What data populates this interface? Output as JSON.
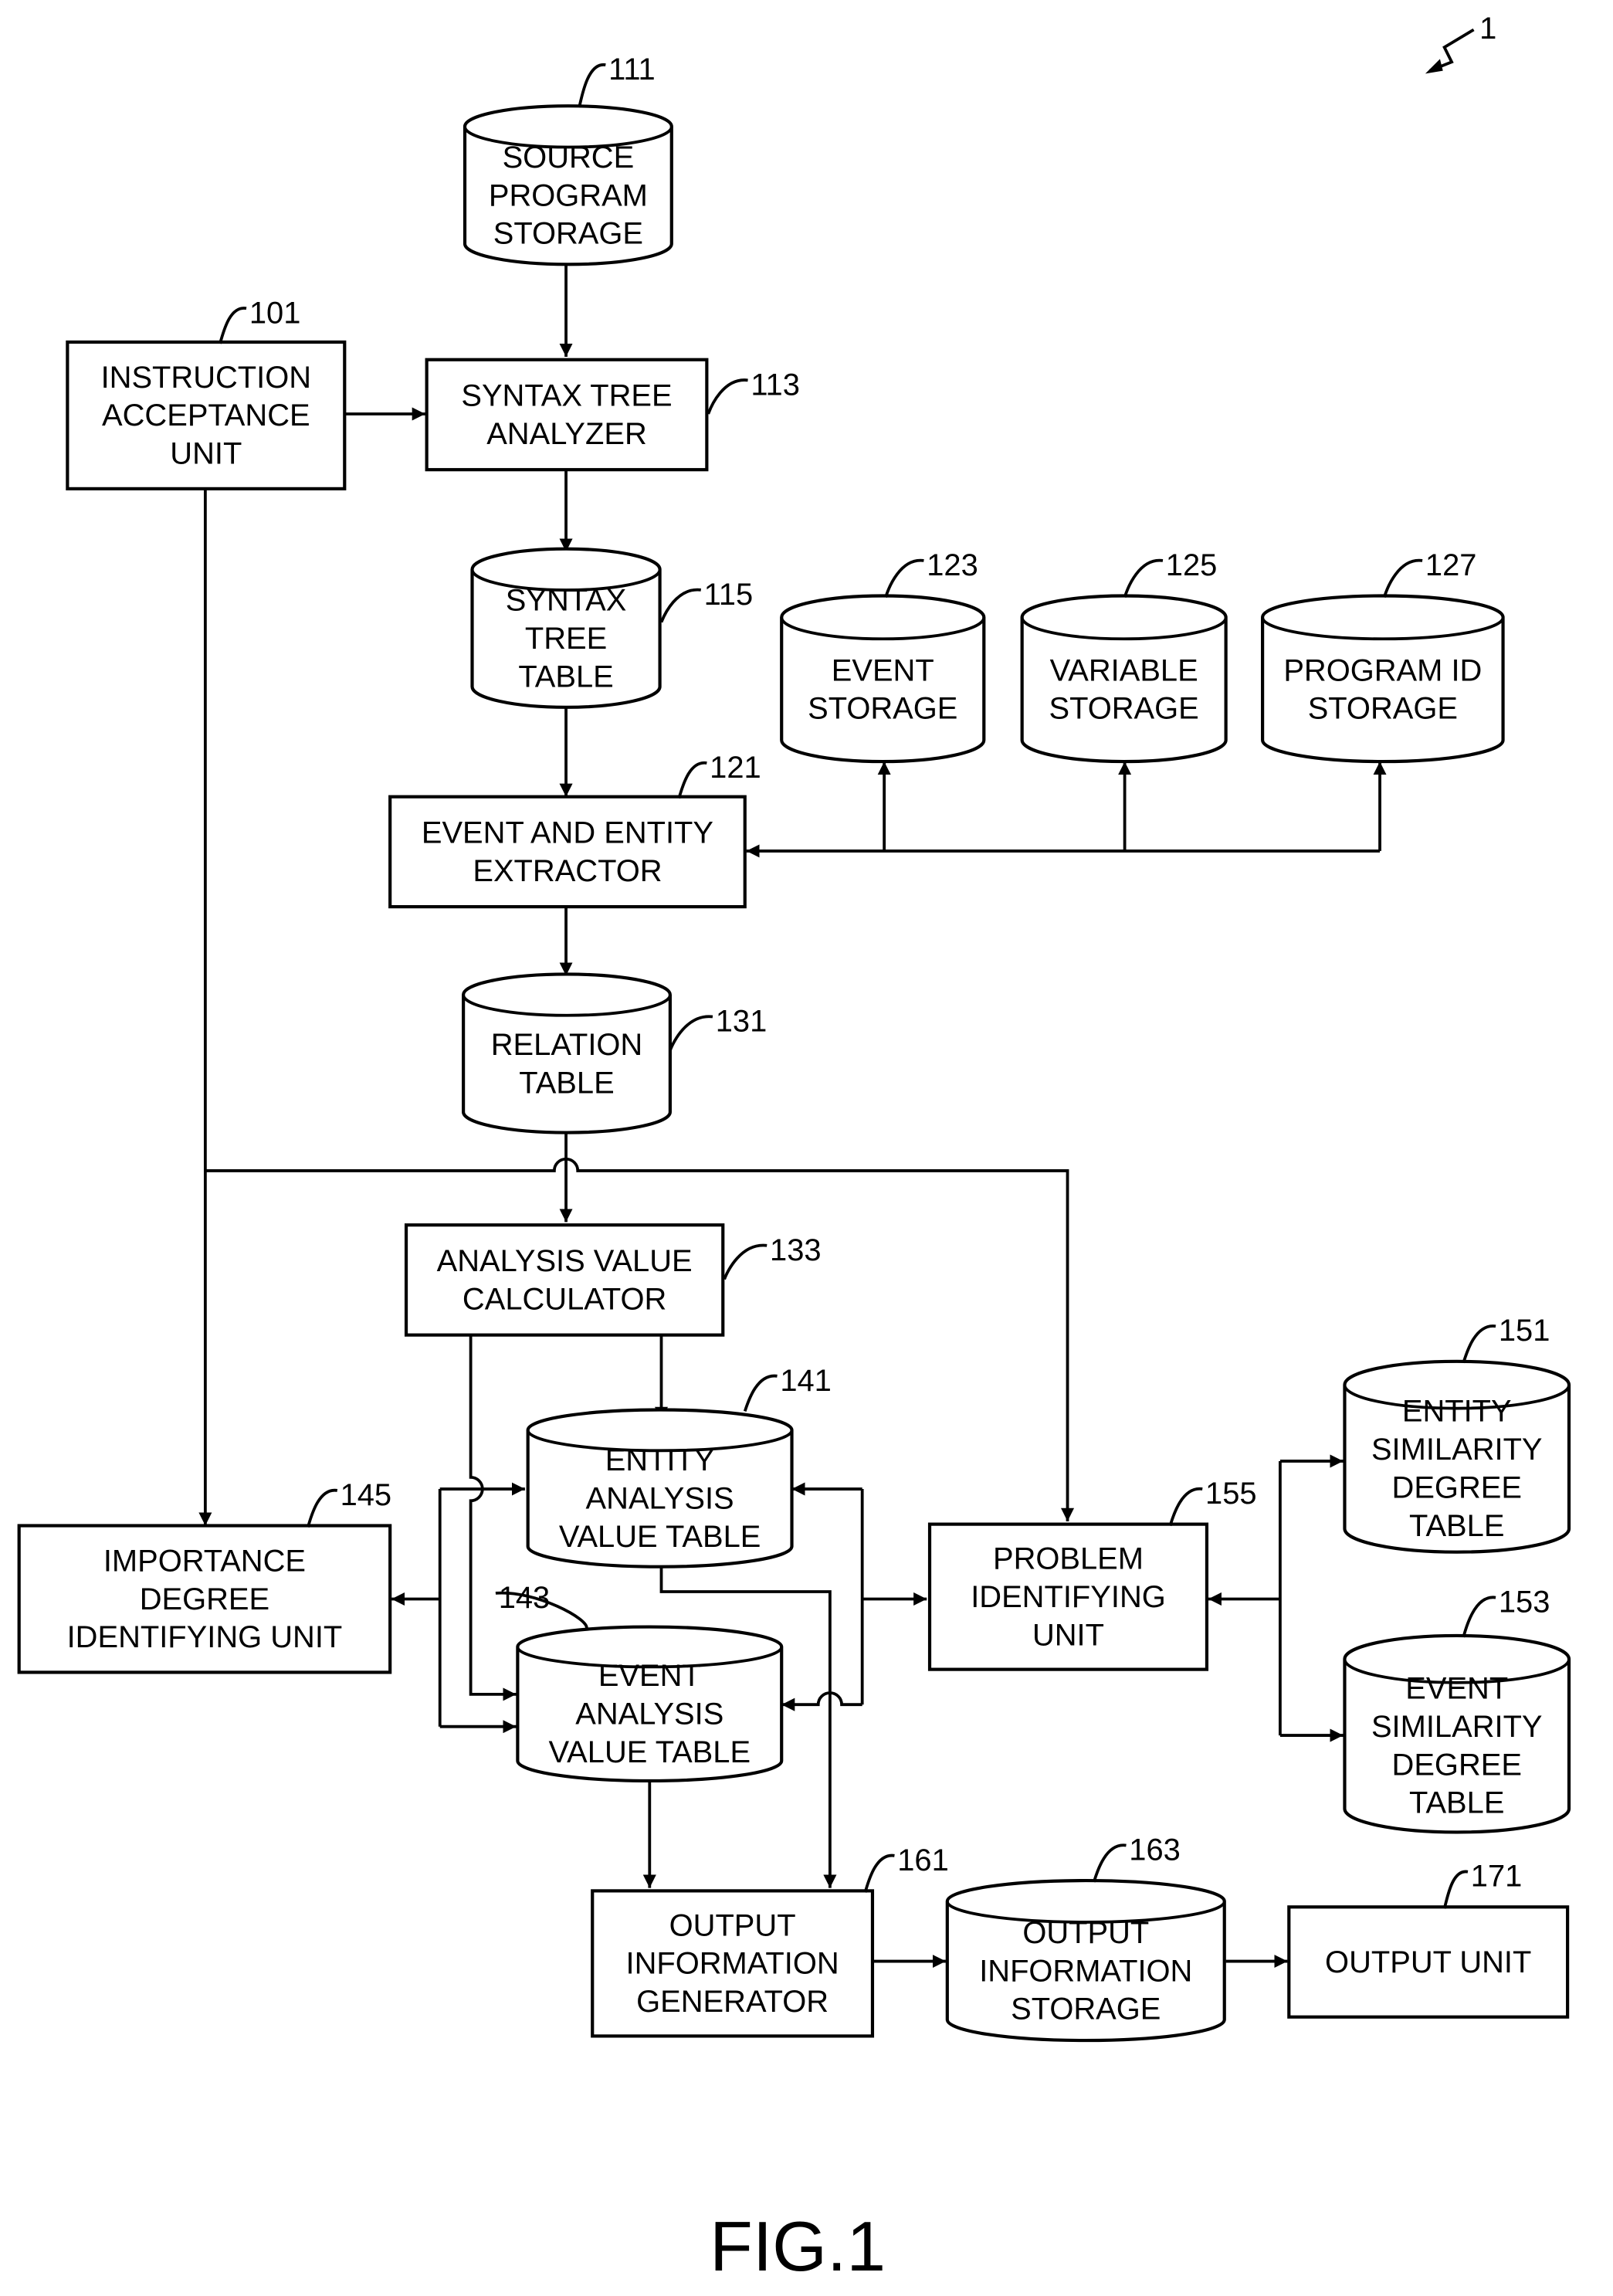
{
  "figure": {
    "caption": "FIG.1",
    "system_ref": "1"
  },
  "nodes": {
    "source_program_storage": {
      "ref": "111",
      "shape": "cylinder",
      "lines": [
        "SOURCE",
        "PROGRAM",
        "STORAGE"
      ]
    },
    "instruction_acceptance_unit": {
      "ref": "101",
      "shape": "box",
      "lines": [
        "INSTRUCTION",
        "ACCEPTANCE",
        "UNIT"
      ]
    },
    "syntax_tree_analyzer": {
      "ref": "113",
      "shape": "box",
      "lines": [
        "SYNTAX TREE",
        "ANALYZER"
      ]
    },
    "syntax_tree_table": {
      "ref": "115",
      "shape": "cylinder",
      "lines": [
        "SYNTAX",
        "TREE",
        "TABLE"
      ]
    },
    "event_storage": {
      "ref": "123",
      "shape": "cylinder",
      "lines": [
        "EVENT",
        "STORAGE"
      ]
    },
    "variable_storage": {
      "ref": "125",
      "shape": "cylinder",
      "lines": [
        "VARIABLE",
        "STORAGE"
      ]
    },
    "program_id_storage": {
      "ref": "127",
      "shape": "cylinder",
      "lines": [
        "PROGRAM ID",
        "STORAGE"
      ]
    },
    "event_entity_extractor": {
      "ref": "121",
      "shape": "box",
      "lines": [
        "EVENT AND ENTITY",
        "EXTRACTOR"
      ]
    },
    "relation_table": {
      "ref": "131",
      "shape": "cylinder",
      "lines": [
        "RELATION",
        "TABLE"
      ]
    },
    "analysis_value_calculator": {
      "ref": "133",
      "shape": "box",
      "lines": [
        "ANALYSIS VALUE",
        "CALCULATOR"
      ]
    },
    "entity_analysis_value_table": {
      "ref": "141",
      "shape": "cylinder",
      "lines": [
        "ENTITY",
        "ANALYSIS",
        "VALUE TABLE"
      ]
    },
    "event_analysis_value_table": {
      "ref": "143",
      "shape": "cylinder",
      "lines": [
        "EVENT",
        "ANALYSIS",
        "VALUE TABLE"
      ]
    },
    "importance_degree_identifying_unit": {
      "ref": "145",
      "shape": "box",
      "lines": [
        "IMPORTANCE",
        "DEGREE",
        "IDENTIFYING UNIT"
      ]
    },
    "problem_identifying_unit": {
      "ref": "155",
      "shape": "box",
      "lines": [
        "PROBLEM",
        "IDENTIFYING",
        "UNIT"
      ]
    },
    "entity_similarity_degree_table": {
      "ref": "151",
      "shape": "cylinder",
      "lines": [
        "ENTITY",
        "SIMILARITY",
        "DEGREE",
        "TABLE"
      ]
    },
    "event_similarity_degree_table": {
      "ref": "153",
      "shape": "cylinder",
      "lines": [
        "EVENT",
        "SIMILARITY",
        "DEGREE",
        "TABLE"
      ]
    },
    "output_information_generator": {
      "ref": "161",
      "shape": "box",
      "lines": [
        "OUTPUT",
        "INFORMATION",
        "GENERATOR"
      ]
    },
    "output_information_storage": {
      "ref": "163",
      "shape": "cylinder",
      "lines": [
        "OUTPUT",
        "INFORMATION",
        "STORAGE"
      ]
    },
    "output_unit": {
      "ref": "171",
      "shape": "box",
      "lines": [
        "OUTPUT UNIT"
      ]
    }
  },
  "edges": [
    {
      "from": "source_program_storage",
      "to": "syntax_tree_analyzer"
    },
    {
      "from": "instruction_acceptance_unit",
      "to": "syntax_tree_analyzer"
    },
    {
      "from": "syntax_tree_analyzer",
      "to": "syntax_tree_table"
    },
    {
      "from": "syntax_tree_table",
      "to": "event_entity_extractor"
    },
    {
      "from": "event_entity_extractor",
      "to": "event_storage",
      "bidirectional": true
    },
    {
      "from": "event_entity_extractor",
      "to": "variable_storage",
      "bidirectional": true
    },
    {
      "from": "event_entity_extractor",
      "to": "program_id_storage",
      "bidirectional": true
    },
    {
      "from": "event_entity_extractor",
      "to": "relation_table"
    },
    {
      "from": "relation_table",
      "to": "analysis_value_calculator"
    },
    {
      "from": "relation_table",
      "to": "problem_identifying_unit"
    },
    {
      "from": "instruction_acceptance_unit",
      "to": "importance_degree_identifying_unit"
    },
    {
      "from": "analysis_value_calculator",
      "to": "entity_analysis_value_table"
    },
    {
      "from": "analysis_value_calculator",
      "to": "event_analysis_value_table"
    },
    {
      "from": "importance_degree_identifying_unit",
      "to": "entity_analysis_value_table",
      "bidirectional": true
    },
    {
      "from": "importance_degree_identifying_unit",
      "to": "event_analysis_value_table",
      "bidirectional": true
    },
    {
      "from": "problem_identifying_unit",
      "to": "entity_analysis_value_table",
      "bidirectional": true
    },
    {
      "from": "problem_identifying_unit",
      "to": "event_analysis_value_table",
      "bidirectional": true
    },
    {
      "from": "problem_identifying_unit",
      "to": "entity_similarity_degree_table",
      "bidirectional": true
    },
    {
      "from": "problem_identifying_unit",
      "to": "event_similarity_degree_table",
      "bidirectional": true
    },
    {
      "from": "entity_analysis_value_table",
      "to": "output_information_generator"
    },
    {
      "from": "event_analysis_value_table",
      "to": "output_information_generator"
    },
    {
      "from": "output_information_generator",
      "to": "output_information_storage"
    },
    {
      "from": "output_information_storage",
      "to": "output_unit"
    }
  ]
}
